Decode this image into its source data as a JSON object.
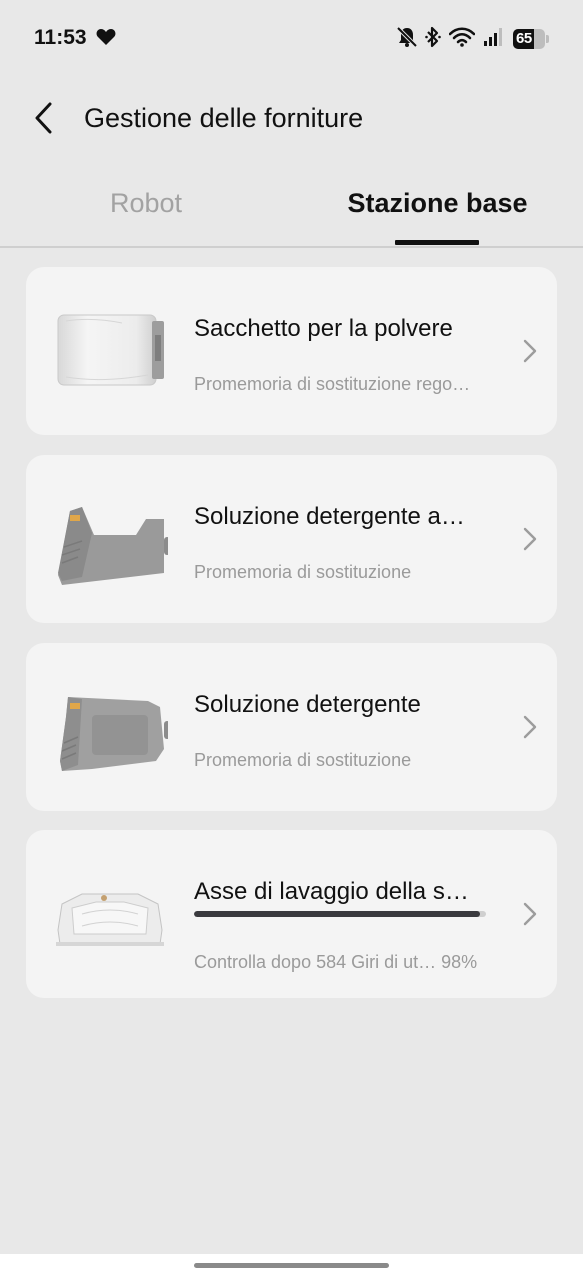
{
  "status_bar": {
    "time": "11:53",
    "battery": "65",
    "battery_level": 0.65,
    "icons": [
      "heart-icon",
      "mute-bell-icon",
      "bluetooth-icon",
      "wifi-icon",
      "signal-icon",
      "battery-icon"
    ]
  },
  "header": {
    "title": "Gestione delle forniture",
    "back_icon": "chevron-left-icon"
  },
  "tabs": [
    {
      "label": "Robot",
      "active": false
    },
    {
      "label": "Stazione base",
      "active": true
    }
  ],
  "items": [
    {
      "title": "Sacchetto per la polvere",
      "subtitle": "Promemoria di sostituzione rego…",
      "image": "dust-bag-image"
    },
    {
      "title": "Soluzione detergente a…",
      "subtitle": "Promemoria di sostituzione",
      "image": "detergent-tank-image"
    },
    {
      "title": "Soluzione detergente",
      "subtitle": "Promemoria di sostituzione",
      "image": "detergent-cartridge-image"
    },
    {
      "title": "Asse di lavaggio della s…",
      "subtitle": "Controlla dopo  584 Giri di ut… 98%",
      "progress": 0.98,
      "image": "wash-tray-image"
    }
  ],
  "colors": {
    "background": "#e8e8e8",
    "card": "#f4f4f4",
    "text": "#111111",
    "muted": "#9a9a9a",
    "progress": "#3a3a3e"
  }
}
